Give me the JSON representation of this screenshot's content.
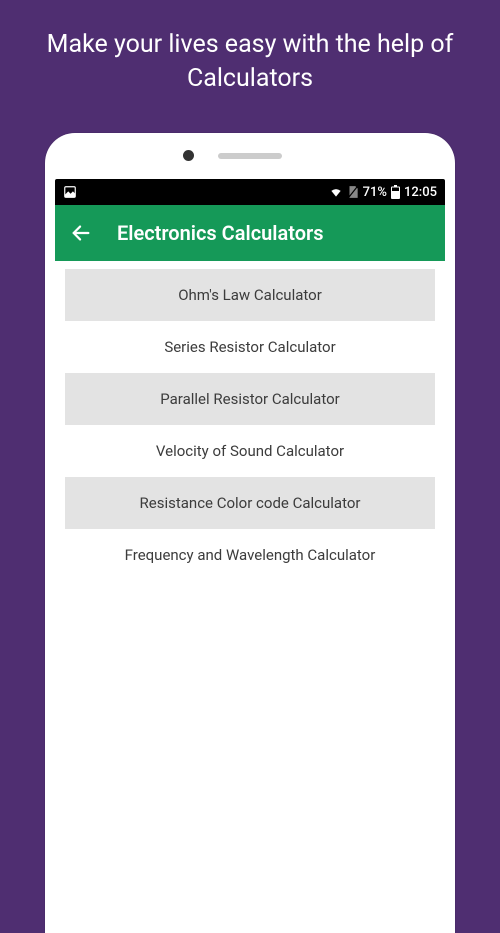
{
  "promo": {
    "headline": "Make your lives easy with the help of Calculators"
  },
  "status_bar": {
    "battery_text": "71%",
    "time_text": "12:05"
  },
  "app_bar": {
    "title": "Electronics Calculators"
  },
  "calculators": {
    "items": [
      {
        "label": "Ohm's Law Calculator"
      },
      {
        "label": "Series Resistor Calculator"
      },
      {
        "label": "Parallel Resistor Calculator"
      },
      {
        "label": "Velocity of Sound Calculator"
      },
      {
        "label": "Resistance Color code Calculator"
      },
      {
        "label": "Frequency and Wavelength Calculator"
      }
    ]
  },
  "colors": {
    "background": "#4f2e71",
    "app_bar": "#159958",
    "alt_row": "#e3e3e3"
  }
}
